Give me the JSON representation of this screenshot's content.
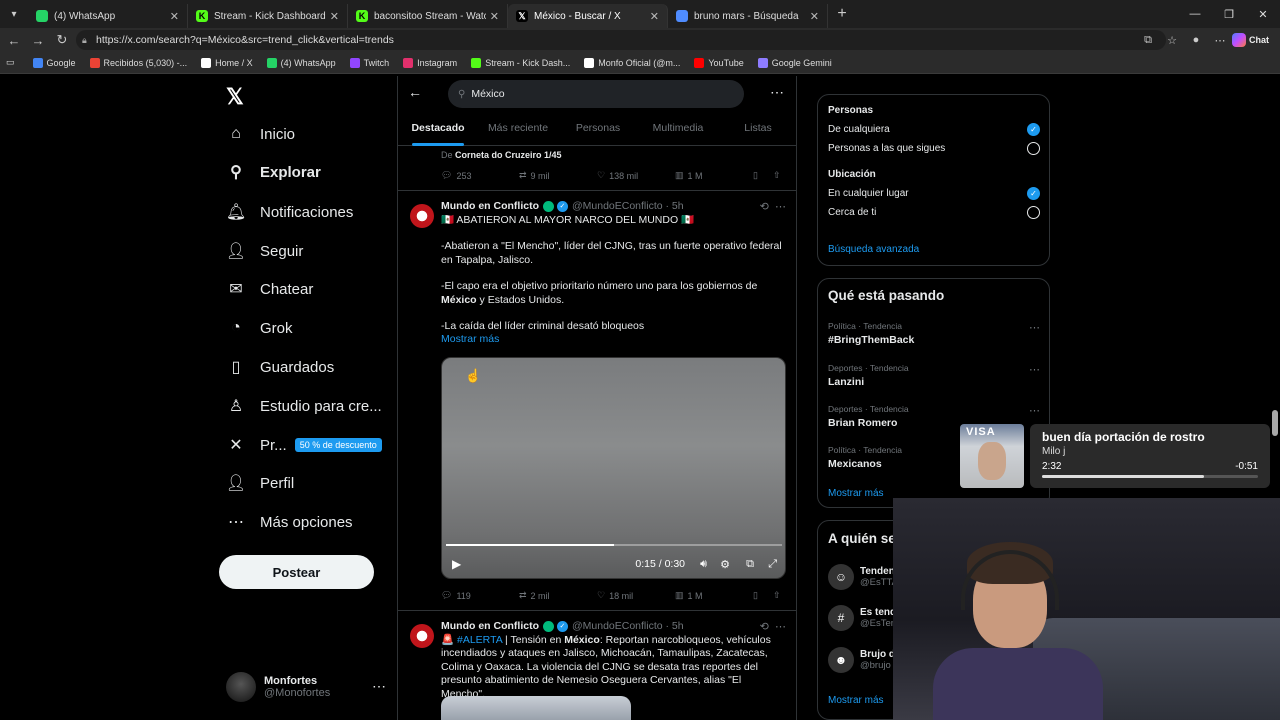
{
  "browser": {
    "tabs": [
      {
        "title": "(4) WhatsApp",
        "fav": "whatsapp",
        "color": "#25d366"
      },
      {
        "title": "Stream - Kick Dashboard",
        "fav": "kick",
        "color": "#53fc18"
      },
      {
        "title": "baconsitoo Stream - Watch Live on",
        "fav": "kick",
        "color": "#53fc18"
      },
      {
        "title": "México - Buscar / X",
        "fav": "x",
        "color": "#ffffff",
        "active": true
      },
      {
        "title": "bruno mars - Búsqueda",
        "fav": "search",
        "color": "#4f8cff"
      }
    ],
    "url": "https://x.com/search?q=México&src=trend_click&vertical=trends",
    "chat_label": "Chat",
    "bookmarks": [
      {
        "label": "Google",
        "color": "#4285f4"
      },
      {
        "label": "Recibidos (5,030) -...",
        "color": "#ea4335"
      },
      {
        "label": "Home / X",
        "color": "#ffffff"
      },
      {
        "label": "(4) WhatsApp",
        "color": "#25d366"
      },
      {
        "label": "Twitch",
        "color": "#9146ff"
      },
      {
        "label": "Instagram",
        "color": "#e1306c"
      },
      {
        "label": "Stream - Kick Dash...",
        "color": "#53fc18"
      },
      {
        "label": "Monfo Oficial (@m...",
        "color": "#ffffff"
      },
      {
        "label": "YouTube",
        "color": "#ff0000"
      },
      {
        "label": "Google Gemini",
        "color": "#8e7cff"
      }
    ]
  },
  "nav": {
    "items": [
      {
        "label": "Inicio",
        "icon": "home-icon",
        "glyph": "⌂"
      },
      {
        "label": "Explorar",
        "icon": "search-icon",
        "glyph": "⚲",
        "bold": true
      },
      {
        "label": "Notificaciones",
        "icon": "bell-icon",
        "glyph": "🔔︎"
      },
      {
        "label": "Seguir",
        "icon": "add-user-icon",
        "glyph": "👤︎"
      },
      {
        "label": "Chatear",
        "icon": "mail-icon",
        "glyph": "✉"
      },
      {
        "label": "Grok",
        "icon": "grok-icon",
        "glyph": "◔"
      },
      {
        "label": "Guardados",
        "icon": "bookmark-icon",
        "glyph": "▯"
      },
      {
        "label": "Estudio para cre...",
        "icon": "creator-icon",
        "glyph": "♙"
      },
      {
        "label": "Pr...",
        "icon": "x-premium-icon",
        "glyph": "✕",
        "promo": "50 % de descuento"
      },
      {
        "label": "Perfil",
        "icon": "profile-icon",
        "glyph": "👤︎"
      },
      {
        "label": "Más opciones",
        "icon": "more-circle-icon",
        "glyph": "⋯"
      }
    ],
    "post_label": "Postear",
    "profile": {
      "name": "Monfortes",
      "handle": "@Monofortes"
    }
  },
  "search": {
    "query": "México",
    "tabs": [
      "Destacado",
      "Más reciente",
      "Personas",
      "Multimedia",
      "Listas"
    ]
  },
  "feed": {
    "prev_quoted": {
      "prefix": "De",
      "source": "Corneta do Cruzeiro 1/45"
    },
    "prev_actions": {
      "replies": "253",
      "reposts": "9 mil",
      "likes": "138 mil",
      "views": "1 M"
    },
    "tweet1": {
      "name": "Mundo en Conflicto",
      "handle": "@MundoEConflicto · 5h",
      "headline": "🇲🇽 ABATIERON AL MAYOR NARCO DEL MUNDO 🇲🇽",
      "p1": "-Abatieron a \"El Mencho\", líder del CJNG, tras un fuerte operativo federal en Tapalpa, Jalisco.",
      "p2a": "-El capo era el objetivo prioritario número uno para los gobiernos de",
      "p2b": "México",
      "p2c": " y Estados Unidos.",
      "p3": "-La caída del líder criminal desató bloqueos",
      "show_more": "Mostrar más",
      "video_time": "0:15 / 0:30",
      "video_progress": 0.5,
      "actions": {
        "replies": "119",
        "reposts": "2 mil",
        "likes": "18 mil",
        "views": "1 M"
      }
    },
    "tweet2": {
      "name": "Mundo en Conflicto",
      "handle": "@MundoEConflicto · 5h",
      "alert_icon": "🚨",
      "hashtag": "#ALERTA",
      "t1": " | Tensión en ",
      "t1b": "México",
      "t2": ": Reportan narcobloqueos, vehículos incendiados y ataques en Jalisco, Michoacán, Tamaulipas, Zacatecas, Colima y Oaxaca. La violencia del CJNG se desata tras reportes del presunto abatimiento de Nemesio Oseguera Cervantes, alias \"El Mencho\"."
    }
  },
  "filters": {
    "people_title": "Personas",
    "people_opts": [
      "De cualquiera",
      "Personas a las que sigues"
    ],
    "location_title": "Ubicación",
    "location_opts": [
      "En cualquier lugar",
      "Cerca de ti"
    ],
    "advanced": "Búsqueda avanzada"
  },
  "trends": {
    "title": "Qué está pasando",
    "items": [
      {
        "meta": "Política · Tendencia",
        "name": "#BringThemBack"
      },
      {
        "meta": "Deportes · Tendencia",
        "name": "Lanzini"
      },
      {
        "meta": "Deportes · Tendencia",
        "name": "Brian Romero"
      },
      {
        "meta": "Política · Tendencia",
        "name": "Mexicanos"
      }
    ],
    "show_more": "Mostrar más"
  },
  "who": {
    "title": "A quién se",
    "items": [
      {
        "name": "Tenden",
        "handle": "@EsTTA"
      },
      {
        "name": "Es tend",
        "handle": "@EsTen"
      },
      {
        "name": "Brujo d",
        "handle": "@brujo"
      }
    ],
    "show_more": "Mostrar más"
  },
  "music": {
    "thumb_text": "VISA",
    "title": "buen día portación de rostro",
    "artist": "Milo j",
    "elapsed": "2:32",
    "remaining": "-0:51",
    "progress": 0.75
  }
}
